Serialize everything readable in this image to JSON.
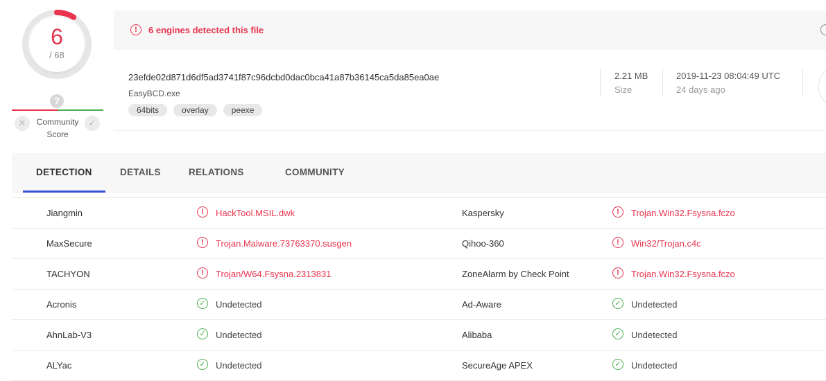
{
  "score": {
    "detected": "6",
    "total": "/ 68",
    "fraction": 0.088,
    "color": "#e8344e"
  },
  "community": {
    "label_line1": "Community",
    "label_line2": "Score",
    "question": "?"
  },
  "alert": {
    "text": "6 engines detected this file"
  },
  "file": {
    "hash": "23efde02d871d6df5ad3741f87c96dcbd0dac0bca41a87b36145ca5da85ea0ae",
    "name": "EasyBCD.exe",
    "tags": [
      "64bits",
      "overlay",
      "peexe"
    ],
    "size_value": "2.21 MB",
    "size_label": "Size",
    "date_value": "2019-11-23 08:04:49 UTC",
    "date_label": "24 days ago"
  },
  "tabs": [
    "DETECTION",
    "DETAILS",
    "RELATIONS",
    "COMMUNITY"
  ],
  "detections": [
    {
      "left_engine": "Jiangmin",
      "left_result": "HackTool.MSIL.dwk",
      "left_status": "malicious",
      "right_engine": "Kaspersky",
      "right_result": "Trojan.Win32.Fsysna.fczo",
      "right_status": "malicious"
    },
    {
      "left_engine": "MaxSecure",
      "left_result": "Trojan.Malware.73763370.susgen",
      "left_status": "malicious",
      "right_engine": "Qihoo-360",
      "right_result": "Win32/Trojan.c4c",
      "right_status": "malicious"
    },
    {
      "left_engine": "TACHYON",
      "left_result": "Trojan/W64.Fsysna.2313831",
      "left_status": "malicious",
      "right_engine": "ZoneAlarm by Check Point",
      "right_result": "Trojan.Win32.Fsysna.fczo",
      "right_status": "malicious"
    },
    {
      "left_engine": "Acronis",
      "left_result": "Undetected",
      "left_status": "clean",
      "right_engine": "Ad-Aware",
      "right_result": "Undetected",
      "right_status": "clean"
    },
    {
      "left_engine": "AhnLab-V3",
      "left_result": "Undetected",
      "left_status": "clean",
      "right_engine": "Alibaba",
      "right_result": "Undetected",
      "right_status": "clean"
    },
    {
      "left_engine": "ALYac",
      "left_result": "Undetected",
      "left_status": "clean",
      "right_engine": "SecureAge APEX",
      "right_result": "Undetected",
      "right_status": "clean"
    }
  ],
  "icons": {
    "malicious": "alert-circle-icon",
    "clean": "check-circle-icon"
  }
}
